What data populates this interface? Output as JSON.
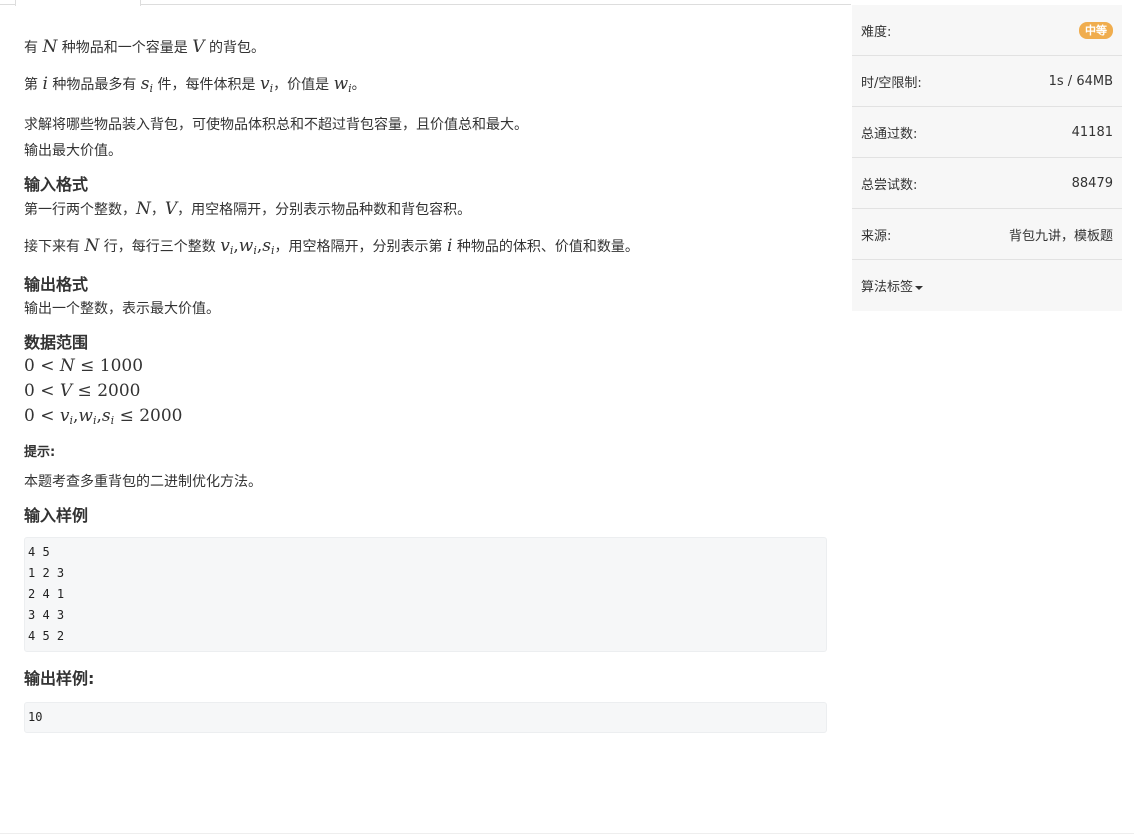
{
  "problem": {
    "l1": [
      "有 ",
      "N",
      " 种物品和一个容量是 ",
      "V",
      " 的背包。"
    ],
    "l2": [
      "第 ",
      "i",
      " 种物品最多有 ",
      "s",
      "i",
      " 件，每件体积是 ",
      "v",
      "i",
      "，价值是 ",
      "w",
      "i",
      "。"
    ],
    "l3": "求解将哪些物品装入背包，可使物品体积总和不超过背包容量，且价值总和最大。",
    "l4": "输出最大价值。"
  },
  "input_format": {
    "heading": "输入格式",
    "l1": [
      "第一行两个整数，",
      "N",
      "，",
      "V",
      "，用空格隔开，分别表示物品种数和背包容积。"
    ],
    "l2": [
      "接下来有 ",
      "N",
      " 行，每行三个整数 ",
      "v",
      "i",
      ",",
      "w",
      "i",
      ",",
      "s",
      "i",
      "，用空格隔开，分别表示第 ",
      "i",
      " 种物品的体积、价值和数量。"
    ]
  },
  "output_format": {
    "heading": "输出格式",
    "l1": "输出一个整数，表示最大价值。"
  },
  "data_range": {
    "heading": "数据范围",
    "r1": [
      "0 < ",
      "N",
      " ≤ 1000"
    ],
    "r2": [
      "0 < ",
      "V",
      " ≤ 2000"
    ],
    "r3": [
      "0 < ",
      "v",
      "i",
      ",",
      "w",
      "i",
      ",",
      "s",
      "i",
      " ≤ 2000"
    ]
  },
  "hint": {
    "heading": "提示:",
    "text": "本题考查多重背包的二进制优化方法。"
  },
  "sample_input": {
    "heading": "输入样例",
    "lines": [
      "4 5",
      "1 2 3",
      "2 4 1",
      "3 4 3",
      "4 5 2"
    ]
  },
  "sample_output": {
    "heading": "输出样例:",
    "lines": [
      "10"
    ]
  },
  "sidebar": {
    "difficulty_label": "难度:",
    "difficulty_value": "中等",
    "limit_label": "时/空限制:",
    "limit_value": "1s / 64MB",
    "passed_label": "总通过数:",
    "passed_value": "41181",
    "attempts_label": "总尝试数:",
    "attempts_value": "88479",
    "source_label": "来源:",
    "source_value": "背包九讲，模板题",
    "tags_label": "算法标签"
  },
  "colors": {
    "badge": "#f0ad4e",
    "sidebar_bg": "#f7f7f7",
    "code_bg": "#f6f7f8"
  }
}
